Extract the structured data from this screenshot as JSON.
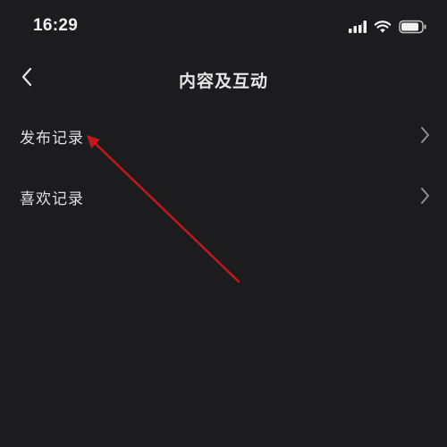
{
  "status_bar": {
    "time": "16:29",
    "icons": [
      "signal-icon",
      "wifi-icon",
      "battery-icon"
    ]
  },
  "nav": {
    "back_icon": "chevron-left-icon",
    "title": "内容及互动"
  },
  "menu": {
    "items": [
      {
        "label": "发布记录",
        "icon": "chevron-right-icon"
      },
      {
        "label": "喜欢记录",
        "icon": "chevron-right-icon"
      }
    ]
  },
  "colors": {
    "background": "#1c1c1e",
    "text": "#e0e0e0",
    "chevron": "#8e8e93",
    "annotation_arrow": "#c0181c"
  }
}
